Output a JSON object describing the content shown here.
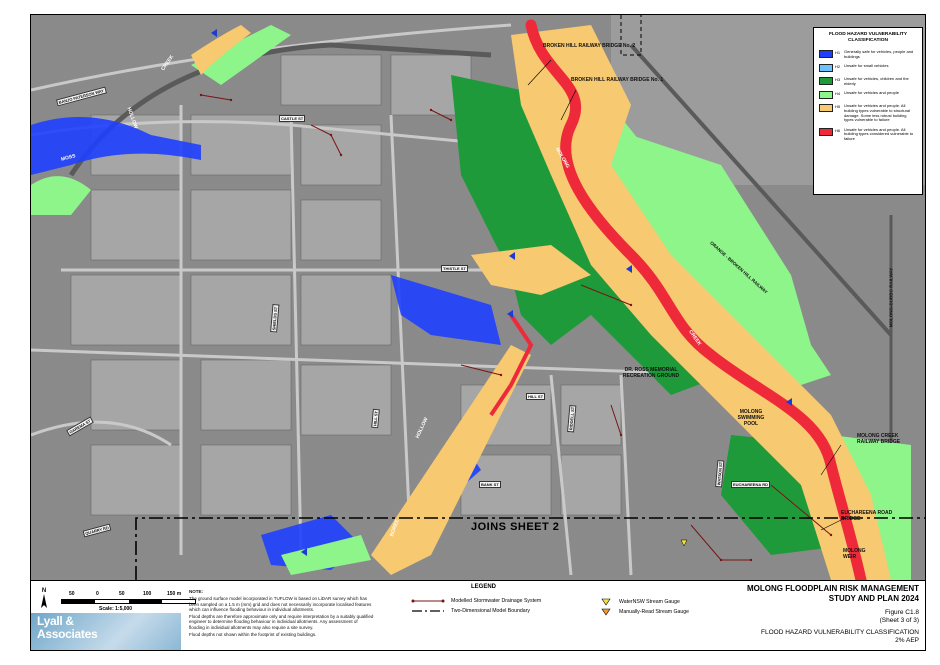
{
  "map_labels": {
    "broken_hill_bridge_2": "BROKEN HILL RAILWAY BRIDGE No. 2",
    "broken_hill_bridge_1": "BROKEN HILL RAILWAY BRIDGE No. 1",
    "molong_creek_a": "MOLONG",
    "molong_creek_b": "CREEK",
    "moss": "MOSS",
    "hollow": "HOLLOW",
    "creek_top": "CREEK",
    "boree": "BOREE",
    "hollow_lower": "HOLLOW",
    "dr_ross": "DR. ROSS MEMORIAL RECREATION GROUND",
    "molong_pool": "MOLONG SWIMMING POOL",
    "molong_creek_bridge": "MOLONG CREEK RAILWAY BRIDGE",
    "euchareena_bridge": "EUCHAREENA ROAD BRIDGE",
    "molong_weir": "MOLONG WEIR",
    "orange_railway": "ORANGE - BROKEN HILL RAILWAY",
    "molong_dubbo": "MOLONG-DUBBO RAILWAY",
    "joins": "JOINS SHEET 2"
  },
  "streets": [
    "BANJO PATERSON WAY",
    "CASTLE ST",
    "THISTLE ST",
    "HILL ST",
    "BANK ST",
    "QUARRY RD",
    "GAREMA ST",
    "SHIELDS ST",
    "HILL ST",
    "RIDDELL ST",
    "WATSON ST",
    "EUCHAREENA RD"
  ],
  "hazard_legend": {
    "title": "FLOOD HAZARD VULNERABILITY CLASSIFICATION",
    "items": [
      {
        "code": "H1",
        "color": "#1f3fff",
        "desc": "Generally safe for vehicles, people and buildings"
      },
      {
        "code": "H2",
        "color": "#6ec3ff",
        "desc": "Unsafe for small vehicles"
      },
      {
        "code": "H3",
        "color": "#1f9a3a",
        "desc": "Unsafe for vehicles, children and the elderly"
      },
      {
        "code": "H4",
        "color": "#8ef58a",
        "desc": "Unsafe for vehicles and people"
      },
      {
        "code": "H5",
        "color": "#f7c970",
        "desc": "Unsafe for vehicles and people. All building types vulnerable to structural damage. Some less robust building types vulnerable to failure"
      },
      {
        "code": "H6",
        "color": "#ee2a3a",
        "desc": "Unsafe for vehicles and people. All building types considered vulnerable to failure"
      }
    ]
  },
  "scale": {
    "ticks": [
      "50",
      "0",
      "50",
      "100",
      "150 m"
    ],
    "label": "Scale: 1:5,000",
    "north": "N"
  },
  "logo": {
    "line1": "Lyall &",
    "line2": "Associates"
  },
  "note": {
    "title": "NOTE:",
    "p1": "The ground surface model incorporated in TUFLOW is based on LiDAR survey which has been sampled on a 1.5 m (mm) grid and does not necessarily incorporate localised features which can influence flooding behaviour in individual allotments.",
    "p2": "Flood depths are therefore approximate only and require interpretation by a suitably qualified engineer to determine flooding behaviour in individual allotments. Any assessment of flooding in individual allotments may also require a site survey.",
    "p3": "Flood depths not shown within the footprint of existing buildings."
  },
  "legend": {
    "title": "LEGEND",
    "stormwater": "Modelled Stormwater Drainage System",
    "boundary": "Two-Dimensional Model Boundary",
    "waternsw": "WaterNSW Stream Gauge",
    "manual": "Manually-Read Stream Gauge"
  },
  "title_block": {
    "line1": "MOLONG FLOODPLAIN RISK MANAGEMENT",
    "line2": "STUDY AND PLAN 2024",
    "figure": "Figure C1.8",
    "sheet": "(Sheet 3 of 3)",
    "class1": "FLOOD HAZARD VULNERABILITY CLASSIFICATION",
    "class2": "2% AEP"
  }
}
